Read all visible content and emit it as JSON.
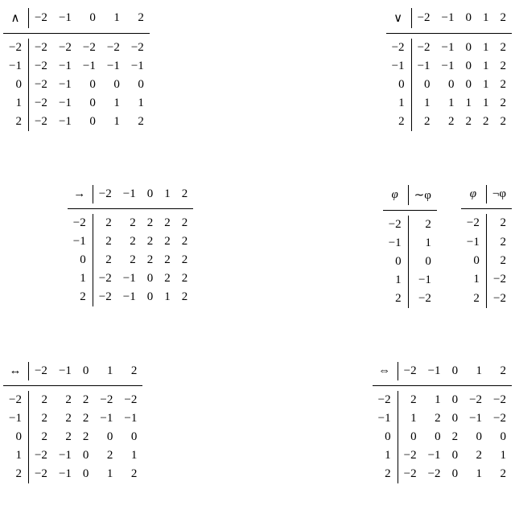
{
  "chart_data": [
    {
      "type": "table",
      "title": "conjunction (∧) truth table over {-2,-1,0,1,2}",
      "row_labels": [
        -2,
        -1,
        0,
        1,
        2
      ],
      "col_labels": [
        -2,
        -1,
        0,
        1,
        2
      ],
      "values": [
        [
          -2,
          -2,
          -2,
          -2,
          -2
        ],
        [
          -2,
          -1,
          -1,
          -1,
          -1
        ],
        [
          -2,
          -1,
          0,
          0,
          0
        ],
        [
          -2,
          -1,
          0,
          1,
          1
        ],
        [
          -2,
          -1,
          0,
          1,
          2
        ]
      ]
    },
    {
      "type": "table",
      "title": "disjunction (∨) truth table over {-2,-1,0,1,2}",
      "row_labels": [
        -2,
        -1,
        0,
        1,
        2
      ],
      "col_labels": [
        -2,
        -1,
        0,
        1,
        2
      ],
      "values": [
        [
          -2,
          -1,
          0,
          1,
          2
        ],
        [
          -1,
          -1,
          0,
          1,
          2
        ],
        [
          0,
          0,
          0,
          1,
          2
        ],
        [
          1,
          1,
          1,
          1,
          2
        ],
        [
          2,
          2,
          2,
          2,
          2
        ]
      ]
    },
    {
      "type": "table",
      "title": "implication (→) truth table over {-2,-1,0,1,2}",
      "row_labels": [
        -2,
        -1,
        0,
        1,
        2
      ],
      "col_labels": [
        -2,
        -1,
        0,
        1,
        2
      ],
      "values": [
        [
          2,
          2,
          2,
          2,
          2
        ],
        [
          2,
          2,
          2,
          2,
          2
        ],
        [
          2,
          2,
          2,
          2,
          2
        ],
        [
          -2,
          -1,
          0,
          2,
          2
        ],
        [
          -2,
          -1,
          0,
          1,
          2
        ]
      ]
    },
    {
      "type": "table",
      "title": "∼φ unary table",
      "row_labels": [
        -2,
        -1,
        0,
        1,
        2
      ],
      "values": [
        2,
        1,
        0,
        -1,
        -2
      ]
    },
    {
      "type": "table",
      "title": "¬φ unary table",
      "row_labels": [
        -2,
        -1,
        0,
        1,
        2
      ],
      "values": [
        2,
        2,
        2,
        -2,
        -2
      ]
    },
    {
      "type": "table",
      "title": "biconditional (↔) truth table over {-2,-1,0,1,2}",
      "row_labels": [
        -2,
        -1,
        0,
        1,
        2
      ],
      "col_labels": [
        -2,
        -1,
        0,
        1,
        2
      ],
      "values": [
        [
          2,
          2,
          2,
          -2,
          -2
        ],
        [
          2,
          2,
          2,
          -1,
          -1
        ],
        [
          2,
          2,
          2,
          0,
          0
        ],
        [
          -2,
          -1,
          0,
          2,
          1
        ],
        [
          -2,
          -1,
          0,
          1,
          2
        ]
      ]
    },
    {
      "type": "table",
      "title": "equivalence (⇔) truth table over {-2,-1,0,1,2}",
      "row_labels": [
        -2,
        -1,
        0,
        1,
        2
      ],
      "col_labels": [
        -2,
        -1,
        0,
        1,
        2
      ],
      "values": [
        [
          2,
          1,
          0,
          -2,
          -2
        ],
        [
          1,
          2,
          0,
          -1,
          -2
        ],
        [
          0,
          0,
          2,
          0,
          0
        ],
        [
          -2,
          -1,
          0,
          2,
          1
        ],
        [
          -2,
          -2,
          0,
          1,
          2
        ]
      ]
    }
  ],
  "ops": {
    "and": {
      "sym": "∧",
      "hdr": [
        "−2",
        "−1",
        "0",
        "1",
        "2"
      ],
      "rows": [
        "−2",
        "−1",
        "0",
        "1",
        "2"
      ],
      "body": [
        [
          "−2",
          "−2",
          "−2",
          "−2",
          "−2"
        ],
        [
          "−2",
          "−1",
          "−1",
          "−1",
          "−1"
        ],
        [
          "−2",
          "−1",
          "0",
          "0",
          "0"
        ],
        [
          "−2",
          "−1",
          "0",
          "1",
          "1"
        ],
        [
          "−2",
          "−1",
          "0",
          "1",
          "2"
        ]
      ]
    },
    "or": {
      "sym": "∨",
      "hdr": [
        "−2",
        "−1",
        "0",
        "1",
        "2"
      ],
      "rows": [
        "−2",
        "−1",
        "0",
        "1",
        "2"
      ],
      "body": [
        [
          "−2",
          "−1",
          "0",
          "1",
          "2"
        ],
        [
          "−1",
          "−1",
          "0",
          "1",
          "2"
        ],
        [
          "0",
          "0",
          "0",
          "1",
          "2"
        ],
        [
          "1",
          "1",
          "1",
          "1",
          "2"
        ],
        [
          "2",
          "2",
          "2",
          "2",
          "2"
        ]
      ]
    },
    "imp": {
      "sym": "→",
      "hdr": [
        "−2",
        "−1",
        "0",
        "1",
        "2"
      ],
      "rows": [
        "−2",
        "−1",
        "0",
        "1",
        "2"
      ],
      "body": [
        [
          "2",
          "2",
          "2",
          "2",
          "2"
        ],
        [
          "2",
          "2",
          "2",
          "2",
          "2"
        ],
        [
          "2",
          "2",
          "2",
          "2",
          "2"
        ],
        [
          "−2",
          "−1",
          "0",
          "2",
          "2"
        ],
        [
          "−2",
          "−1",
          "0",
          "1",
          "2"
        ]
      ]
    },
    "tilde": {
      "sym_a": "φ",
      "sym_b": "∼φ",
      "rows": [
        "−2",
        "−1",
        "0",
        "1",
        "2"
      ],
      "vals": [
        "2",
        "1",
        "0",
        "−1",
        "−2"
      ]
    },
    "neg": {
      "sym_a": "φ",
      "sym_b": "¬φ",
      "rows": [
        "−2",
        "−1",
        "0",
        "1",
        "2"
      ],
      "vals": [
        "2",
        "2",
        "2",
        "−2",
        "−2"
      ]
    },
    "bicon": {
      "sym": "↔",
      "hdr": [
        "−2",
        "−1",
        "0",
        "1",
        "2"
      ],
      "rows": [
        "−2",
        "−1",
        "0",
        "1",
        "2"
      ],
      "body": [
        [
          "2",
          "2",
          "2",
          "−2",
          "−2"
        ],
        [
          "2",
          "2",
          "2",
          "−1",
          "−1"
        ],
        [
          "2",
          "2",
          "2",
          "0",
          "0"
        ],
        [
          "−2",
          "−1",
          "0",
          "2",
          "1"
        ],
        [
          "−2",
          "−1",
          "0",
          "1",
          "2"
        ]
      ]
    },
    "equiv": {
      "sym": "⇔",
      "hdr": [
        "−2",
        "−1",
        "0",
        "1",
        "2"
      ],
      "rows": [
        "−2",
        "−1",
        "0",
        "1",
        "2"
      ],
      "body": [
        [
          "2",
          "1",
          "0",
          "−2",
          "−2"
        ],
        [
          "1",
          "2",
          "0",
          "−1",
          "−2"
        ],
        [
          "0",
          "0",
          "2",
          "0",
          "0"
        ],
        [
          "−2",
          "−1",
          "0",
          "2",
          "1"
        ],
        [
          "−2",
          "−2",
          "0",
          "1",
          "2"
        ]
      ]
    }
  }
}
